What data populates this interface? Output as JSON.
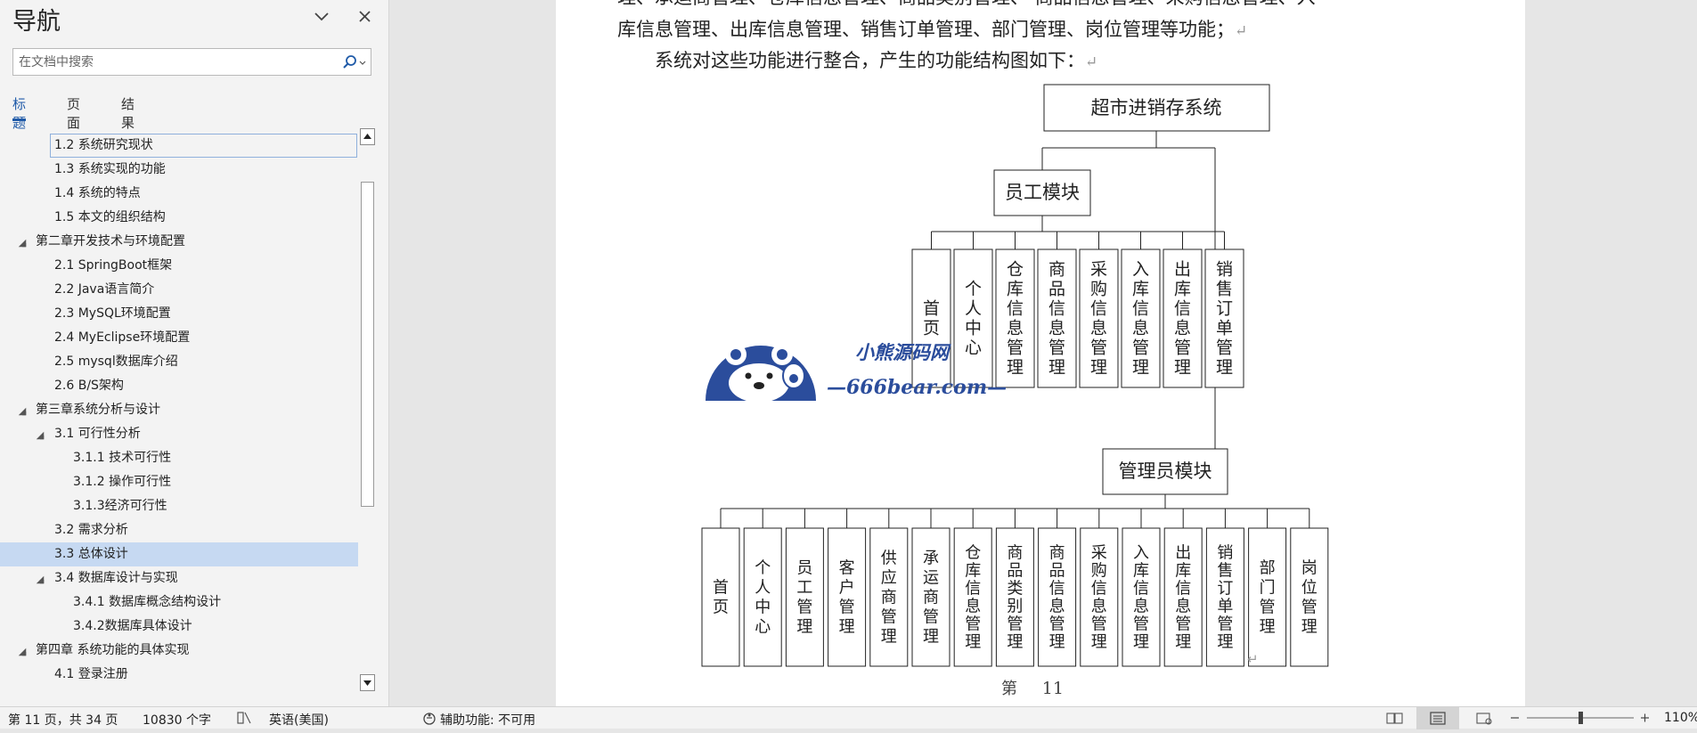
{
  "nav": {
    "title": "导航",
    "search_placeholder": "在文档中搜索",
    "tabs": [
      {
        "label": "标题",
        "active": true
      },
      {
        "label": "页面",
        "active": false
      },
      {
        "label": "结果",
        "active": false
      }
    ],
    "tree": [
      {
        "label": "1.2  系统研究现状",
        "level": 2,
        "state": "focused"
      },
      {
        "label": "1.3  系统实现的功能",
        "level": 2
      },
      {
        "label": "1.4  系统的特点",
        "level": 2
      },
      {
        "label": "1.5  本文的组织结构",
        "level": 2
      },
      {
        "label": "第二章开发技术与环境配置",
        "level": 1,
        "expanded": true
      },
      {
        "label": "2.1  SpringBoot框架",
        "level": 2
      },
      {
        "label": " 2.2  Java语言简介",
        "level": 2
      },
      {
        "label": "2.3  MySQL环境配置",
        "level": 2
      },
      {
        "label": "2.4  MyEclipse环境配置",
        "level": 2
      },
      {
        "label": "2.5  mysql数据库介绍",
        "level": 2
      },
      {
        "label": "2.6  B/S架构",
        "level": 2
      },
      {
        "label": "第三章系统分析与设计",
        "level": 1,
        "expanded": true
      },
      {
        "label": "3.1 可行性分析",
        "level": 2,
        "expanded": true
      },
      {
        "label": "3.1.1 技术可行性",
        "level": 3
      },
      {
        "label": "3.1.2 操作可行性",
        "level": 3
      },
      {
        "label": "3.1.3经济可行性",
        "level": 3
      },
      {
        "label": "3.2  需求分析",
        "level": 2
      },
      {
        "label": "3.3  总体设计",
        "level": 2,
        "state": "selected"
      },
      {
        "label": "3.4  数据库设计与实现",
        "level": 2,
        "expanded": true
      },
      {
        "label": "3.4.1  数据库概念结构设计",
        "level": 3
      },
      {
        "label": "3.4.2数据库具体设计",
        "level": 3
      },
      {
        "label": "第四章  系统功能的具体实现",
        "level": 1,
        "expanded": true
      },
      {
        "label": "4.1 登录注册",
        "level": 2
      }
    ]
  },
  "document": {
    "line1": "理、承运商管理、仓库信息管理、商品类别管理、 商品信息管理、采购信息管理、入",
    "line2": "库信息管理、出库信息管理、销售订单管理、部门管理、岗位管理等功能；",
    "line3": "系统对这些功能进行整合，产生的功能结构图如下：",
    "paragraph_mark": "↵",
    "page_footer_prefix": "第",
    "page_footer_number": "11",
    "org_chart": {
      "root": "超市进销存系统",
      "modules": [
        {
          "name": "员工模块",
          "functions": [
            "首页",
            "个人中心",
            "仓库信息管理",
            "商品信息管理",
            "采购信息管理",
            "入库信息管理",
            "出库信息管理",
            "销售订单管理"
          ]
        },
        {
          "name": "管理员模块",
          "functions": [
            "首页",
            "个人中心",
            "员工管理",
            "客户管理",
            "供应商管理",
            "承运商管理",
            "仓库信息管理",
            "商品类别管理",
            "商品信息管理",
            "采购信息管理",
            "入库信息管理",
            "出库信息管理",
            "销售订单管理",
            "部门管理",
            "岗位管理"
          ]
        }
      ]
    },
    "watermark": {
      "line1": "小熊源码网",
      "line2": "—666bear.com—"
    }
  },
  "status": {
    "page_info": "第 11 页，共 34 页",
    "word_count": "10830 个字",
    "language": "英语(美国)",
    "accessibility": "辅助功能: 不可用",
    "zoom": "110%"
  },
  "colors": {
    "accent": "#1f5aa8",
    "selection": "#c6d9f2",
    "watermark": "#2b4d9c"
  }
}
